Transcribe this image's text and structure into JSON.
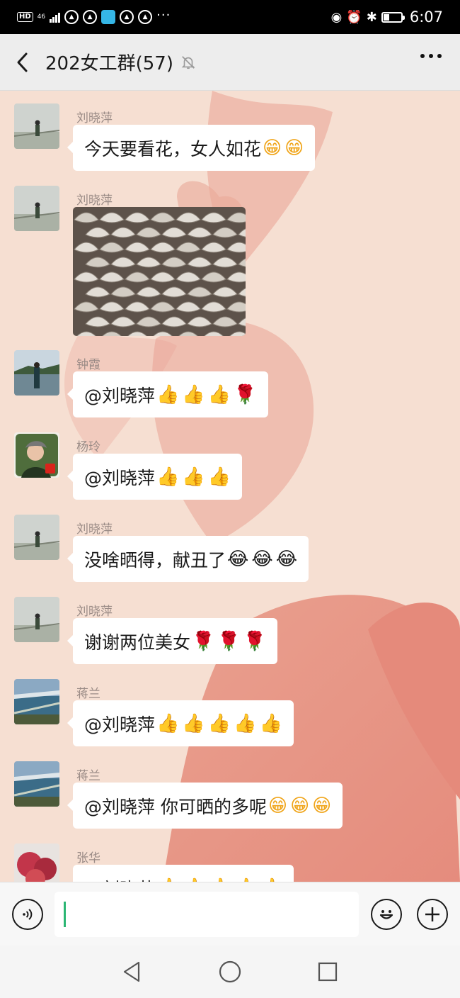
{
  "status_bar": {
    "hd_badge": "HD",
    "network": "46",
    "more_notifications": "···",
    "time": "6:07",
    "battery_level": 0.35
  },
  "header": {
    "title": "202女工群(57)"
  },
  "messages": [
    {
      "sender": "刘晓萍",
      "text": "今天要看花，女人如花",
      "emojis": [
        "grin",
        "grin"
      ]
    },
    {
      "sender": "刘晓萍",
      "type": "image"
    },
    {
      "sender": "钟霞",
      "text": "@刘晓萍 ",
      "emojis": [
        "thumbs-up",
        "thumbs-up",
        "thumbs-up",
        "rose"
      ]
    },
    {
      "sender": "杨玲",
      "text": "@刘晓萍 ",
      "emojis": [
        "thumbs-up",
        "thumbs-up",
        "thumbs-up"
      ]
    },
    {
      "sender": "刘晓萍",
      "text": "没啥晒得，献丑了",
      "emojis": [
        "laugh-cry",
        "laugh-cry",
        "laugh-cry"
      ]
    },
    {
      "sender": "刘晓萍",
      "text": "谢谢两位美女",
      "emojis": [
        "rose",
        "rose",
        "rose"
      ]
    },
    {
      "sender": "蒋兰",
      "text": "@刘晓萍 ",
      "emojis": [
        "thumbs-up",
        "thumbs-up",
        "thumbs-up",
        "thumbs-up",
        "thumbs-up"
      ]
    },
    {
      "sender": "蒋兰",
      "text": "@刘晓萍  你可晒的多呢",
      "emojis": [
        "grin",
        "grin",
        "grin"
      ]
    },
    {
      "sender": "张华",
      "text": "@刘晓萍 ",
      "emojis": [
        "thumbs-up",
        "thumbs-up",
        "thumbs-up",
        "thumbs-up",
        "thumbs-up"
      ]
    }
  ],
  "input": {
    "value": ""
  }
}
